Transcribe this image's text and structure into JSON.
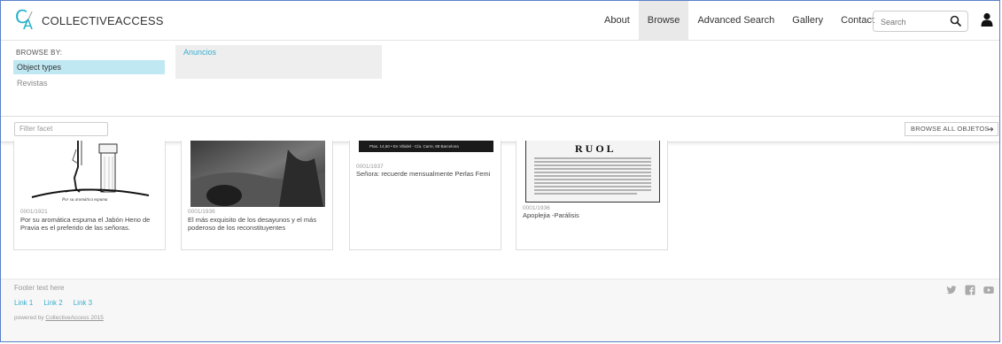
{
  "brand": {
    "logo_text": "COLLECTIVEACCESS",
    "accent": "#1fb0c8"
  },
  "nav": {
    "items": [
      "About",
      "Browse",
      "Advanced Search",
      "Gallery",
      "Contact"
    ],
    "active": "Browse"
  },
  "search": {
    "placeholder": "Search"
  },
  "browse": {
    "label": "BROWSE BY:",
    "facets": [
      {
        "label": "Object types",
        "selected": true
      },
      {
        "label": "Revistas",
        "selected": false
      }
    ],
    "results": [
      "Anuncios"
    ]
  },
  "filter": {
    "placeholder": "Filter facet",
    "browse_all": "BROWSE ALL OBJETOS"
  },
  "cards": [
    {
      "idno": "0001/1921",
      "caption": "Por su aromática espuma el Jabón Heno de Pravia es el preferido de las señoras.",
      "image_text": "Por su aromática espuma"
    },
    {
      "idno": "0001/1936",
      "caption": "El más exquisito de los desayunos y el más poderoso de los reconstituyentes"
    },
    {
      "idno": "0001/1937",
      "caption": "Señora: recuerde mensualmente Perlas Femi",
      "image_text": "Ptas. 14,50 • En Vibidel - Cía. Carre, 88 Barcelona"
    },
    {
      "idno": "0001/1936",
      "caption": "Apoplejia -Parálisis",
      "image_text": "RUOL"
    }
  ],
  "footer": {
    "text": "Footer text here",
    "links": [
      "Link 1",
      "Link 2",
      "Link 3"
    ],
    "powered_prefix": "powered by ",
    "powered_link": "CollectiveAccess 2015",
    "social": [
      "twitter-icon",
      "facebook-icon",
      "youtube-icon"
    ]
  }
}
